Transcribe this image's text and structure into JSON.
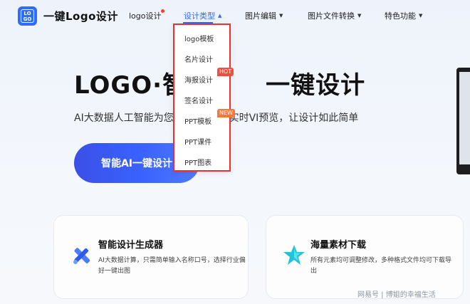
{
  "brand": {
    "logo_line1": "LO",
    "logo_line2": "GO",
    "name": "一键Logo设计"
  },
  "nav": {
    "items": [
      {
        "label": "logo设计",
        "has_dot": true
      },
      {
        "label": "设计类型",
        "active": true
      },
      {
        "label": "图片编辑"
      },
      {
        "label": "图片文件转换"
      },
      {
        "label": "特色功能"
      }
    ]
  },
  "dropdown": {
    "items": [
      {
        "label": "logo模板"
      },
      {
        "label": "名片设计"
      },
      {
        "label": "海报设计",
        "badge": "HOT"
      },
      {
        "label": "签名设计"
      },
      {
        "label": "PPT模板",
        "badge": "NEW"
      },
      {
        "label": "PPT课件"
      },
      {
        "label": "PPT图表"
      }
    ]
  },
  "hero": {
    "title": "LOGO·智",
    "title_tail": "一键设计",
    "subtitle": "AI大数据人工智能为您",
    "subtitle_tail": "GO，实时VI预览，让设计如此简单",
    "cta_label": "智能AI一键设计"
  },
  "cards": [
    {
      "title": "智能设计生成器",
      "desc": "AI大数据计算，只需简单输入名称口号，选择行业偏好一键出图"
    },
    {
      "title": "海量素材下载",
      "desc": "所有元素均可调整修改，多种格式文件均可下载导出"
    }
  ],
  "watermark": "网易号 | 博姐的幸福生活",
  "colors": {
    "accent": "#2f6bff",
    "highlight_border": "#e8322b",
    "hot": "#f04e3e",
    "new": "#f47a3b"
  }
}
